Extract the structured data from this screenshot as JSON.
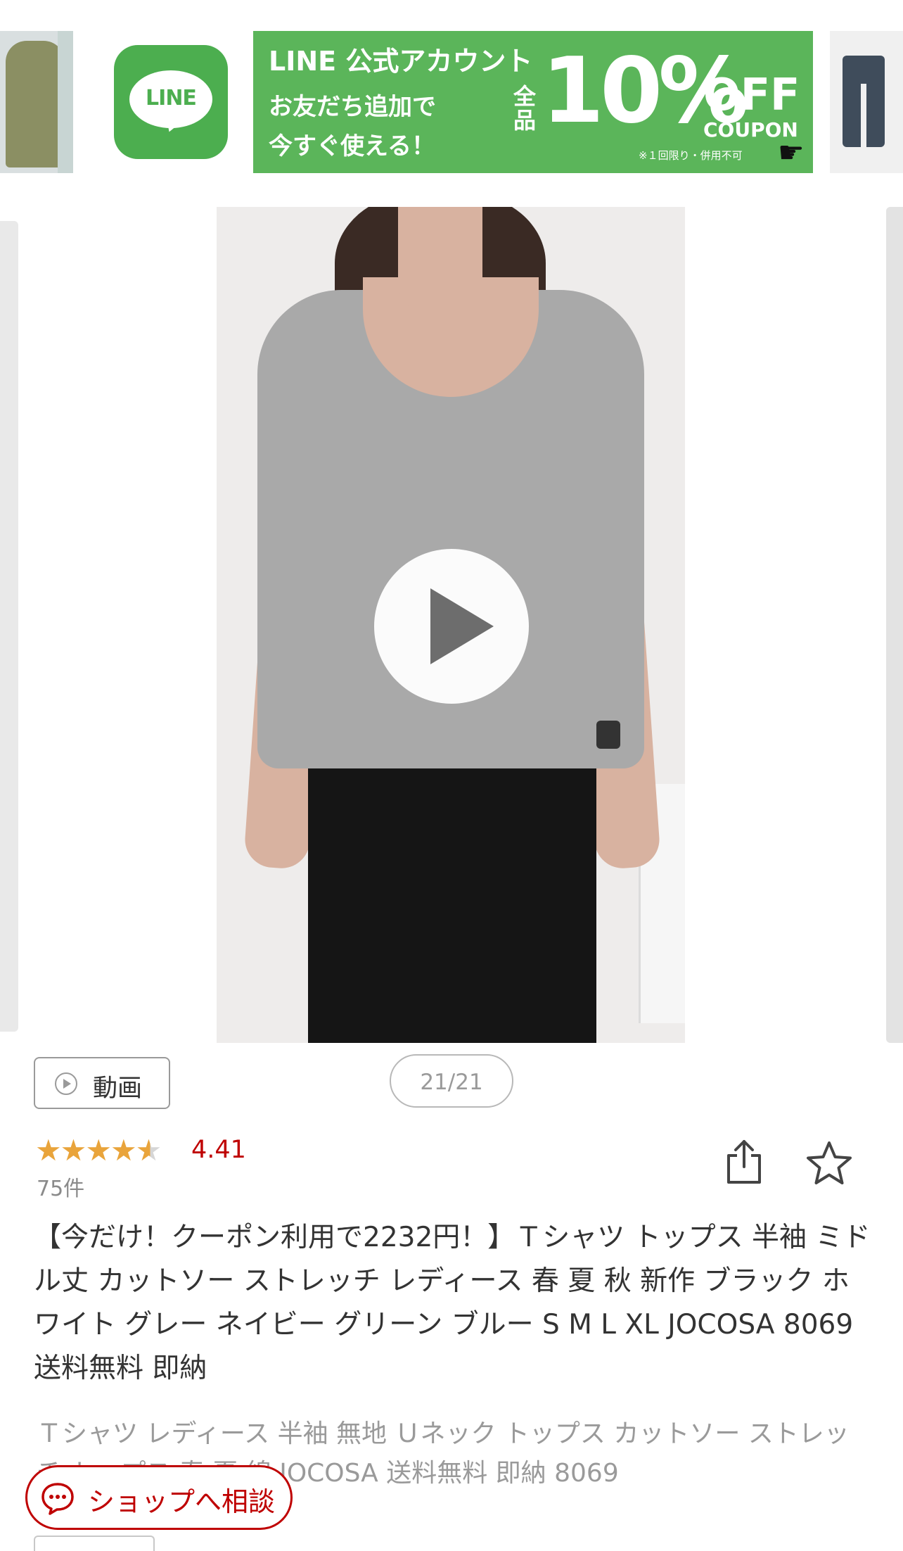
{
  "banner": {
    "logo_text": "LINE",
    "title": "LINE 公式アカウント",
    "line1": "お友だち追加で",
    "line2": "今すぐ使える！",
    "zenpin": "全品",
    "discount": "10%",
    "off": "OFF",
    "coupon": "COUPON",
    "note": "※１回限り・併用不可",
    "colors": {
      "line_green": "#5bb55a",
      "logo_green": "#4cae4f"
    }
  },
  "gallery": {
    "video_label": "動画",
    "counter": "21/21"
  },
  "rating": {
    "value": "4.41",
    "stars": 4.41,
    "count": "75件",
    "star_color": "#e9a43b"
  },
  "product": {
    "title": "【今だけ！クーポン利用で2232円！】Ｔシャツ トップス 半袖 ミドル丈 カットソー ストレッチ レディース 春 夏 秋 新作 ブラック ホワイト グレー ネイビー グリーン ブルー S M L XL JOCOSA 8069 送料無料 即納",
    "subtitle": "Ｔシャツ レディース 半袖 無地 Ｕネック トップス カットソー ストレッチ トップス 春 夏 綿 JOCOSA 送料無料 即納 8069"
  },
  "chat": {
    "label": "ショップへ相談",
    "accent": "#bf0000"
  },
  "icons": {
    "share": "share-icon",
    "favorite": "star-outline-icon",
    "play": "play-icon",
    "chat": "chat-bubble-icon"
  }
}
